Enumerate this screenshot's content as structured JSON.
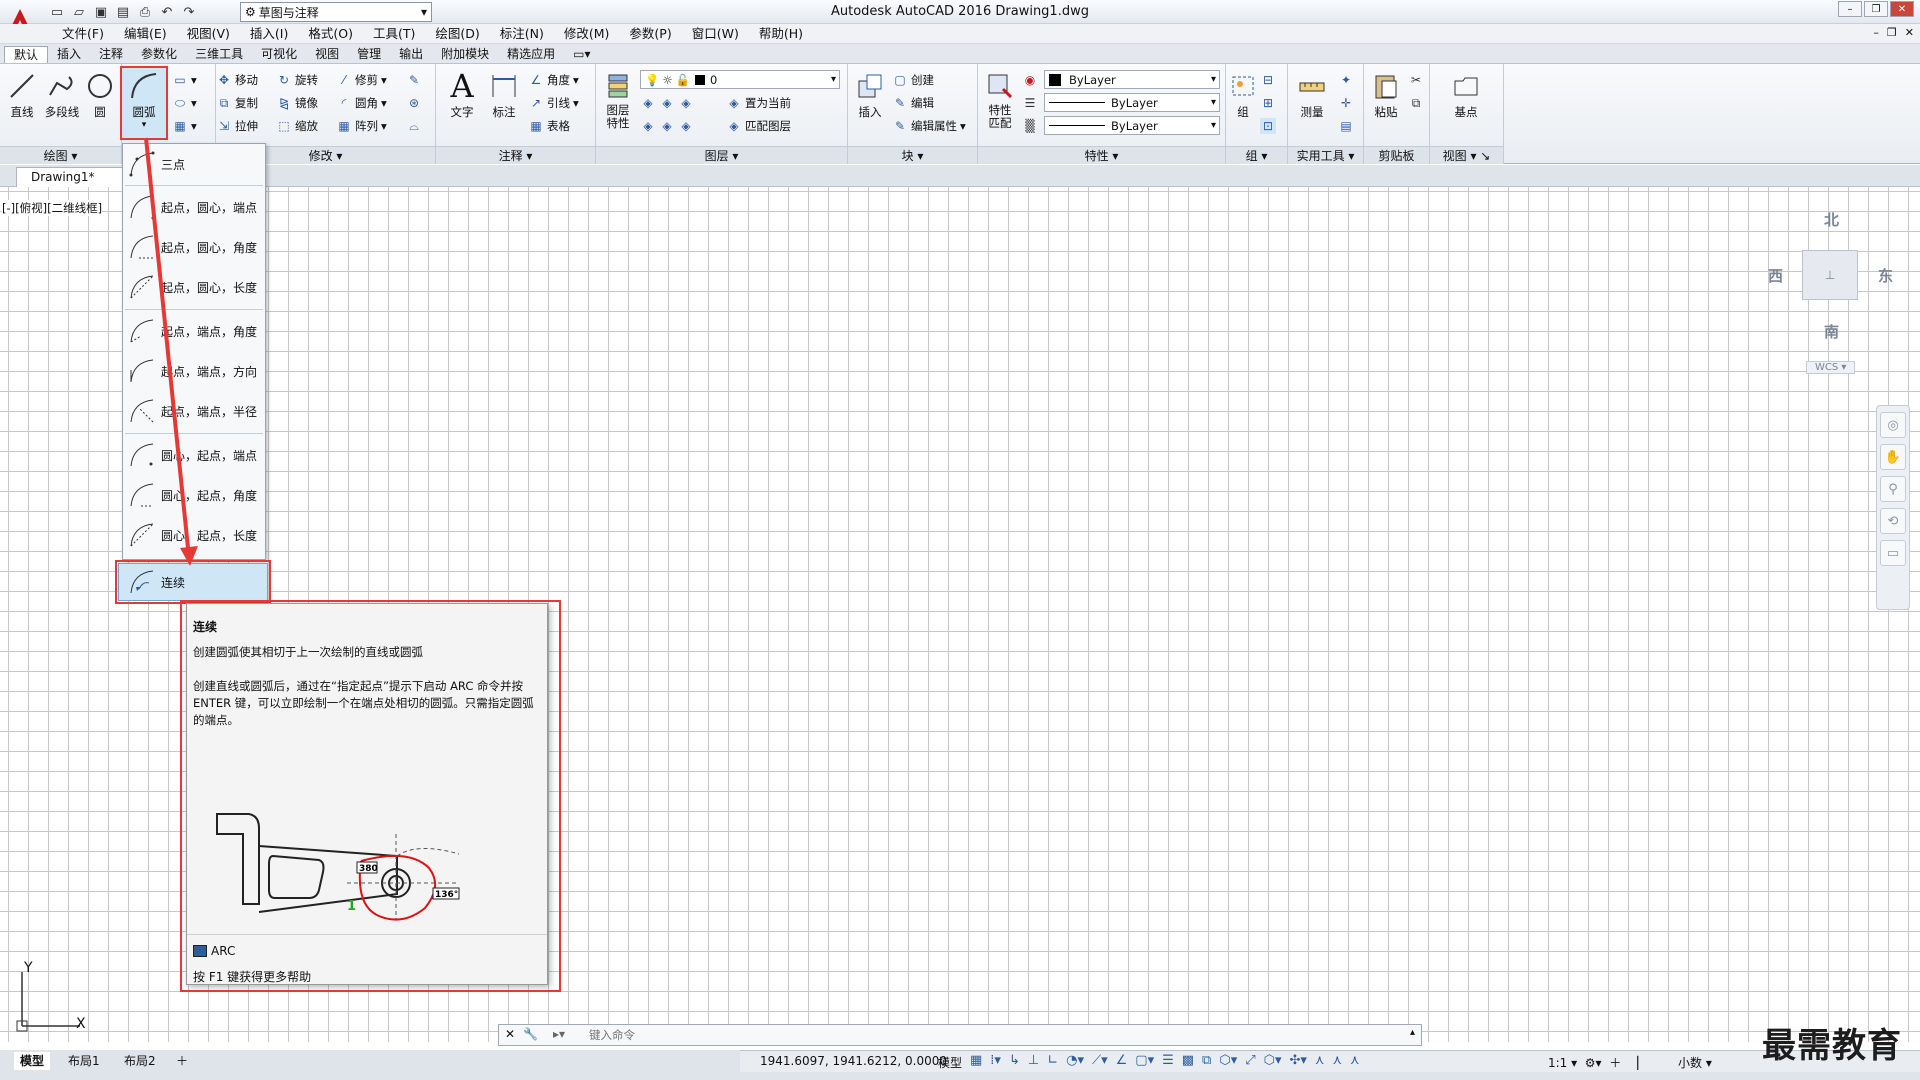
{
  "window": {
    "title": "Autodesk AutoCAD 2016    Drawing1.dwg",
    "workspace": "草图与注释"
  },
  "menus": [
    "文件(F)",
    "编辑(E)",
    "视图(V)",
    "插入(I)",
    "格式(O)",
    "工具(T)",
    "绘图(D)",
    "标注(N)",
    "修改(M)",
    "参数(P)",
    "窗口(W)",
    "帮助(H)"
  ],
  "tabs": [
    "默认",
    "插入",
    "注释",
    "参数化",
    "三维工具",
    "可视化",
    "视图",
    "管理",
    "输出",
    "附加模块",
    "精选应用"
  ],
  "ribbon": {
    "draw": {
      "line": "直线",
      "polyline": "多段线",
      "circle": "圆",
      "arc": "圆弧",
      "title": "绘图"
    },
    "modify": {
      "move": "移动",
      "rotate": "旋转",
      "trim": "修剪",
      "copy": "复制",
      "mirror": "镜像",
      "fillet": "圆角",
      "stretch": "拉伸",
      "scale": "缩放",
      "array": "阵列",
      "title": "修改"
    },
    "annotation": {
      "text": "文字",
      "dimension": "标注",
      "angle": "角度",
      "leader": "引线",
      "table": "表格",
      "title": "注释"
    },
    "layers": {
      "layer_props": "图层特性",
      "current_layer": "0",
      "set_current": "置为当前",
      "match_layer": "匹配图层",
      "title": "图层"
    },
    "block": {
      "insert": "插入",
      "create": "创建",
      "edit": "编辑",
      "edit_attr": "编辑属性",
      "title": "块"
    },
    "properties": {
      "match": "特性匹配",
      "color": "ByLayer",
      "linetype": "ByLayer",
      "lineweight": "ByLayer",
      "title": "特性"
    },
    "groups": {
      "group": "组",
      "title": "组"
    },
    "utilities": {
      "measure": "测量",
      "title": "实用工具"
    },
    "clipboard": {
      "paste": "粘贴",
      "title": "剪贴板"
    },
    "view": {
      "base": "基点",
      "title": "视图"
    }
  },
  "doc_tab": "Drawing1*",
  "viewport_label": "[-][俯视][二维线框]",
  "viewcube": {
    "north": "北",
    "south": "南",
    "east": "东",
    "west": "西",
    "wcs": "WCS"
  },
  "arc_menu": {
    "items": [
      "三点",
      "起点，圆心，端点",
      "起点，圆心，角度",
      "起点，圆心，长度",
      "起点，端点，角度",
      "起点，端点，方向",
      "起点，端点，半径",
      "圆心，起点，端点",
      "圆心，起点，角度",
      "圆心，起点，长度"
    ],
    "continue": "连续"
  },
  "tooltip": {
    "title": "连续",
    "desc": "创建圆弧使其相切于上一次绘制的直线或圆弧",
    "detail": "创建直线或圆弧后，通过在“指定起点”提示下启动 ARC 命令并按 ENTER 键，可以立即绘制一个在端点处相切的圆弧。只需指定圆弧的端点。",
    "dim1": "380",
    "dim2": "136°",
    "marker": "1",
    "command": "ARC",
    "help": "按 F1 键获得更多帮助"
  },
  "command_line": {
    "placeholder": "键入命令"
  },
  "ucs": {
    "x": "X",
    "y": "Y"
  },
  "layout_tabs": [
    "模型",
    "布局1",
    "布局2"
  ],
  "status": {
    "coords": "1941.6097, 1941.6212, 0.0000",
    "model": "模型",
    "scale": "1:1",
    "units": "小数"
  },
  "watermark": "最需教育",
  "colors": {
    "highlight": "#e53935",
    "selected": "#cfe6f7"
  }
}
